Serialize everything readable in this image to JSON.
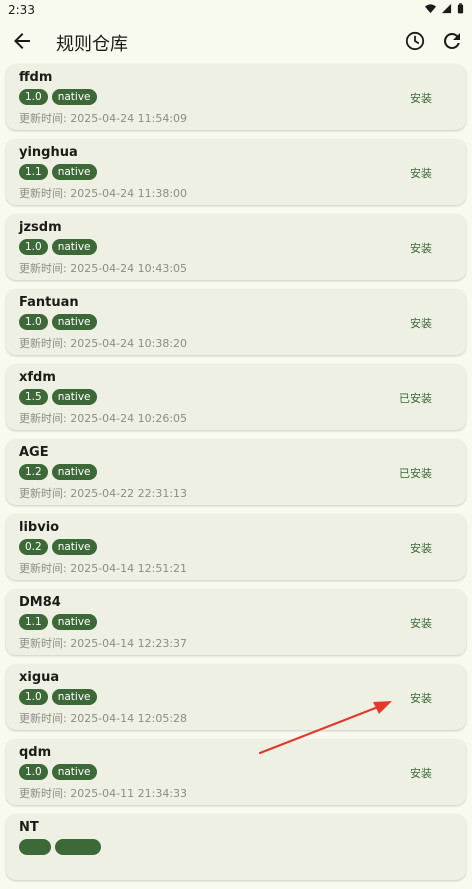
{
  "status_bar": {
    "time": "2:33"
  },
  "app_bar": {
    "title": "规则仓库"
  },
  "colors": {
    "accent": "#3d6838",
    "arrow": "#e23a2a",
    "background": "#f8faf0",
    "card": "#eef0e4"
  },
  "rules": [
    {
      "name": "ffdm",
      "version": "1.0",
      "type": "native",
      "updated": "更新时间: 2025-04-24 11:54:09",
      "action": "安装"
    },
    {
      "name": "yinghua",
      "version": "1.1",
      "type": "native",
      "updated": "更新时间: 2025-04-24 11:38:00",
      "action": "安装"
    },
    {
      "name": "jzsdm",
      "version": "1.0",
      "type": "native",
      "updated": "更新时间: 2025-04-24 10:43:05",
      "action": "安装"
    },
    {
      "name": "Fantuan",
      "version": "1.0",
      "type": "native",
      "updated": "更新时间: 2025-04-24 10:38:20",
      "action": "安装"
    },
    {
      "name": "xfdm",
      "version": "1.5",
      "type": "native",
      "updated": "更新时间: 2025-04-24 10:26:05",
      "action": "已安装"
    },
    {
      "name": "AGE",
      "version": "1.2",
      "type": "native",
      "updated": "更新时间: 2025-04-22 22:31:13",
      "action": "已安装"
    },
    {
      "name": "libvio",
      "version": "0.2",
      "type": "native",
      "updated": "更新时间: 2025-04-14 12:51:21",
      "action": "安装"
    },
    {
      "name": "DM84",
      "version": "1.1",
      "type": "native",
      "updated": "更新时间: 2025-04-14 12:23:37",
      "action": "安装"
    },
    {
      "name": "xigua",
      "version": "1.0",
      "type": "native",
      "updated": "更新时间: 2025-04-14 12:05:28",
      "action": "安装"
    },
    {
      "name": "qdm",
      "version": "1.0",
      "type": "native",
      "updated": "更新时间: 2025-04-11 21:34:33",
      "action": "安装"
    },
    {
      "name": "NT",
      "version": "",
      "type": "",
      "updated": "",
      "action": ""
    }
  ]
}
